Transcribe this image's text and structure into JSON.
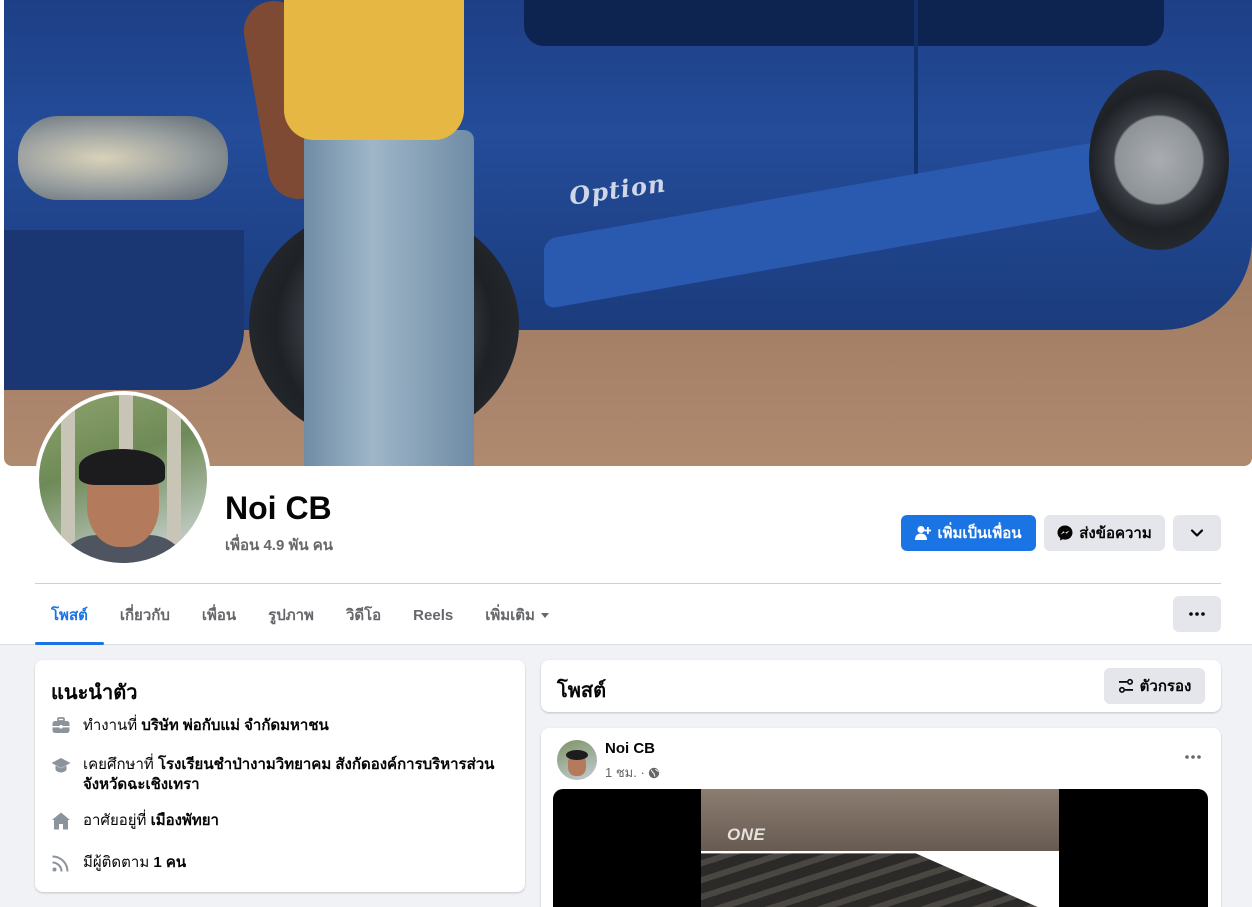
{
  "profile": {
    "name": "Noi CB",
    "friends_count": "เพื่อน 4.9 พัน คน"
  },
  "cover": {
    "car_badge": "Option"
  },
  "actions": {
    "add_friend_label": "เพิ่มเป็นเพื่อน",
    "message_label": "ส่งข้อความ"
  },
  "tabs": [
    {
      "label": "โพสต์",
      "active": true
    },
    {
      "label": "เกี่ยวกับ"
    },
    {
      "label": "เพื่อน"
    },
    {
      "label": "รูปภาพ"
    },
    {
      "label": "วิดีโอ"
    },
    {
      "label": "Reels"
    },
    {
      "label": "เพิ่มเติม"
    }
  ],
  "intro": {
    "title": "แนะนำตัว",
    "work_prefix": "ทำงานที่",
    "work_value": "บริษัท พ่อกับแม่ จำกัดมหาชน",
    "school_prefix": "เคยศึกษาที่",
    "school_value": "โรงเรียนชำป่างามวิทยาคม สังกัดองค์การบริหารส่วนจังหวัดฉะเชิงเทรา",
    "lives_prefix": "อาศัยอยู่ที่",
    "lives_value": "เมืองพัทยา",
    "followers_prefix": "มีผู้ติดตาม",
    "followers_value": "1 คน"
  },
  "posts": {
    "title": "โพสต์",
    "filter_label": "ตัวกรอง",
    "post": {
      "author": "Noi CB",
      "time": "1 ชม. ·",
      "media_logo": "ONE"
    }
  },
  "colors": {
    "accent": "#1b74e4",
    "page_bg": "#f0f2f5",
    "secondary_button": "#e4e6eb",
    "muted_text": "#65676b"
  },
  "icons": [
    "add-friend-icon",
    "messenger-icon",
    "chevron-down-icon",
    "more-icon",
    "briefcase-icon",
    "graduation-cap-icon",
    "home-icon",
    "rss-icon",
    "filter-icon",
    "globe-icon"
  ]
}
